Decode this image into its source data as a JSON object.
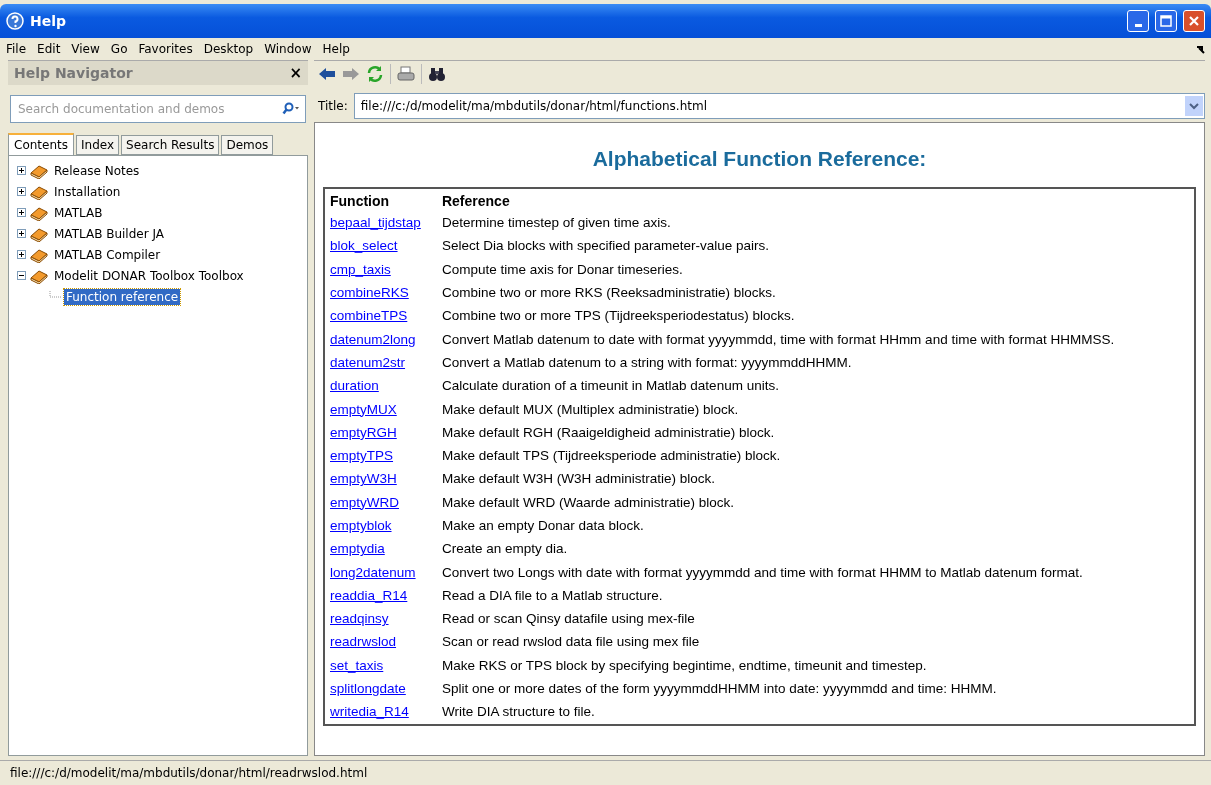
{
  "window": {
    "title": "Help"
  },
  "menu": [
    "File",
    "Edit",
    "View",
    "Go",
    "Favorites",
    "Desktop",
    "Window",
    "Help"
  ],
  "navigator": {
    "title": "Help Navigator",
    "close": "×",
    "search": {
      "placeholder": "Search documentation and demos"
    },
    "tabs": [
      {
        "label": "Contents",
        "selected": true
      },
      {
        "label": "Index",
        "selected": false
      },
      {
        "label": "Search Results",
        "selected": false
      },
      {
        "label": "Demos",
        "selected": false
      }
    ],
    "tree": [
      {
        "label": "Release Notes",
        "expanded": false,
        "selected": false
      },
      {
        "label": "Installation",
        "expanded": false,
        "selected": false
      },
      {
        "label": "MATLAB",
        "expanded": false,
        "selected": false
      },
      {
        "label": "MATLAB Builder JA",
        "expanded": false,
        "selected": false
      },
      {
        "label": "MATLAB Compiler",
        "expanded": false,
        "selected": false
      },
      {
        "label": "Modelit DONAR Toolbox Toolbox",
        "expanded": true,
        "selected": false,
        "children": [
          {
            "label": "Function reference",
            "selected": true
          }
        ]
      }
    ]
  },
  "address": {
    "label": "Title:",
    "value": "file:///c:/d/modelit/ma/mbdutils/donar/html/functions.html"
  },
  "page": {
    "heading": "Alphabetical Function Reference:",
    "columns": [
      "Function",
      "Reference"
    ],
    "rows": [
      [
        "bepaal_tijdstap",
        "Determine timestep of given time axis."
      ],
      [
        "blok_select",
        "Select Dia blocks with specified parameter-value pairs."
      ],
      [
        "cmp_taxis",
        "Compute time axis for Donar timeseries."
      ],
      [
        "combineRKS",
        "Combine two or more RKS (Reeksadministratie) blocks."
      ],
      [
        "combineTPS",
        "Combine two or more TPS (Tijdreeksperiodestatus) blocks."
      ],
      [
        "datenum2long",
        "Convert Matlab datenum to date with format yyyymmdd, time with format HHmm and time with format HHMMSS."
      ],
      [
        "datenum2str",
        "Convert a Matlab datenum to a string with format: yyyymmddHHMM."
      ],
      [
        "duration",
        "Calculate duration of a timeunit in Matlab datenum units."
      ],
      [
        "emptyMUX",
        "Make default MUX (Multiplex administratie) block."
      ],
      [
        "emptyRGH",
        "Make default RGH (Raaigeldigheid administratie) block."
      ],
      [
        "emptyTPS",
        "Make default TPS (Tijdreeksperiode administratie) block."
      ],
      [
        "emptyW3H",
        "Make default W3H (W3H administratie) block."
      ],
      [
        "emptyWRD",
        "Make default WRD (Waarde administratie) block."
      ],
      [
        "emptyblok",
        "Make an empty Donar data block."
      ],
      [
        "emptydia",
        "Create an empty dia."
      ],
      [
        "long2datenum",
        "Convert two Longs with date with format yyyymmdd and time with format HHMM to Matlab datenum format."
      ],
      [
        "readdia_R14",
        "Read a DIA file to a Matlab structure."
      ],
      [
        "readqinsy",
        "Read or scan Qinsy datafile using mex-file"
      ],
      [
        "readrwslod",
        "Scan or read rwslod data file using mex file"
      ],
      [
        "set_taxis",
        "Make RKS or TPS block by specifying begintime, endtime, timeunit and timestep."
      ],
      [
        "splitlongdate",
        "Split one or more dates of the form yyyymmddHHMM into date: yyyymmdd and time: HHMM."
      ],
      [
        "writedia_R14",
        "Write DIA structure to file."
      ]
    ]
  },
  "status_bar": "file:///c:/d/modelit/ma/mbdutils/donar/html/readrwslod.html"
}
